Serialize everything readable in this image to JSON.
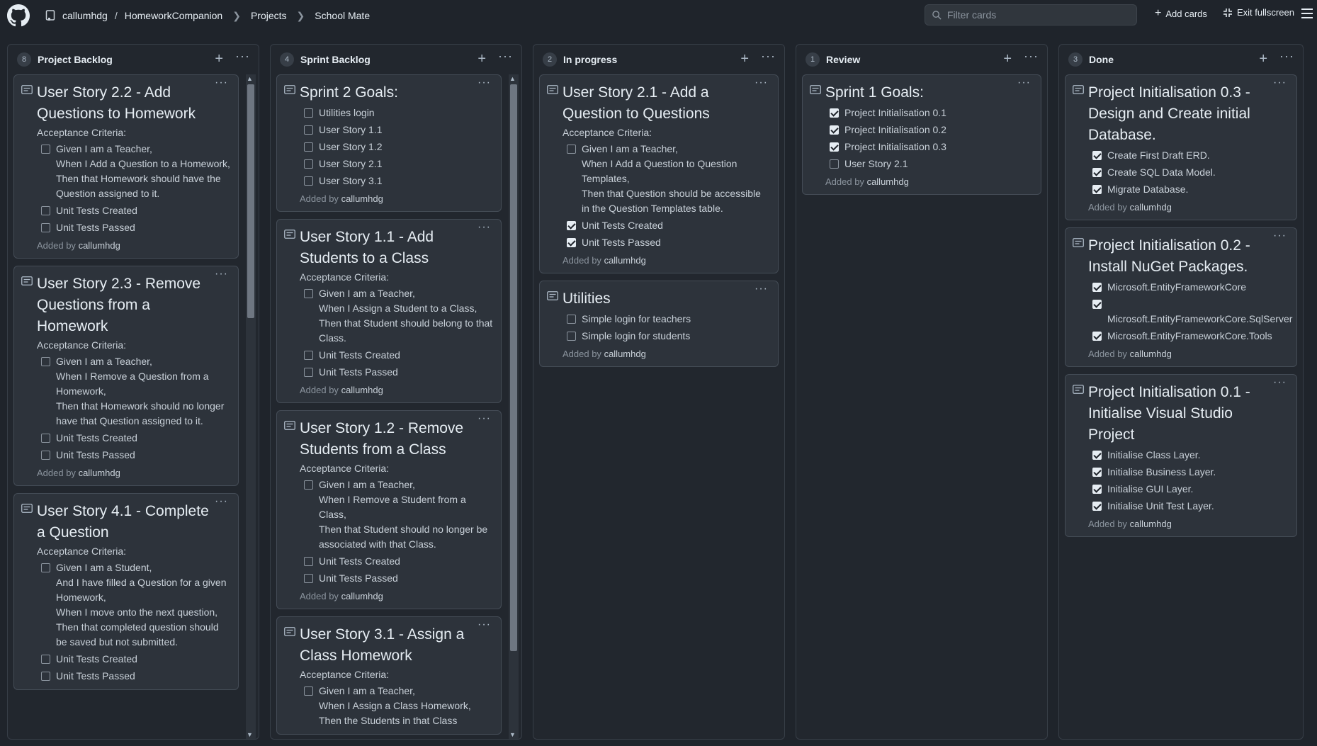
{
  "header": {
    "owner": "callumhdg",
    "repo": "HomeworkCompanion",
    "projects": "Projects",
    "project": "School Mate",
    "filter_placeholder": "Filter cards",
    "add_cards": "Add cards",
    "exit_fullscreen": "Exit fullscreen"
  },
  "columns": [
    {
      "count": "8",
      "title": "Project Backlog",
      "cards": [
        {
          "title": "User Story 2.2 - Add Questions to Homework",
          "sub": "Acceptance Criteria:",
          "items": [
            {
              "text": "Given I am a Teacher,\n When I Add a Question to a Homework,\n Then that Homework should have the Question assigned to it.",
              "checked": false
            },
            {
              "text": "Unit Tests Created",
              "checked": false
            },
            {
              "text": "Unit Tests Passed",
              "checked": false
            }
          ],
          "added_prefix": "Added by",
          "added_by": "callumhdg"
        },
        {
          "title": "User Story 2.3 - Remove Questions from a Homework",
          "sub": "Acceptance Criteria:",
          "items": [
            {
              "text": "Given I am a Teacher,\n When I Remove a Question from a Homework,\n Then that Homework should no longer have that Question assigned to it.",
              "checked": false
            },
            {
              "text": "Unit Tests Created",
              "checked": false
            },
            {
              "text": "Unit Tests Passed",
              "checked": false
            }
          ],
          "added_prefix": "Added by",
          "added_by": "callumhdg"
        },
        {
          "title": "User Story 4.1 - Complete a Question",
          "sub": "Acceptance Criteria:",
          "items": [
            {
              "text": "Given I am a Student,\n And I have filled a Question for a given Homework,\n When I move onto the next question,\n Then that completed question should be saved but not submitted.",
              "checked": false
            },
            {
              "text": "Unit Tests Created",
              "checked": false
            },
            {
              "text": "Unit Tests Passed",
              "checked": false
            }
          ],
          "added_prefix": "",
          "added_by": ""
        }
      ]
    },
    {
      "count": "4",
      "title": "Sprint Backlog",
      "cards": [
        {
          "title": "Sprint 2 Goals:",
          "sub": "",
          "items": [
            {
              "text": "Utilities login",
              "checked": false
            },
            {
              "text": "User Story 1.1",
              "checked": false
            },
            {
              "text": "User Story 1.2",
              "checked": false
            },
            {
              "text": "User Story 2.1",
              "checked": false
            },
            {
              "text": "User Story 3.1",
              "checked": false
            }
          ],
          "added_prefix": "Added by",
          "added_by": "callumhdg"
        },
        {
          "title": "User Story 1.1 - Add Students to a Class",
          "sub": "Acceptance Criteria:",
          "items": [
            {
              "text": "Given I am a Teacher,\n When I Assign a Student to a Class,\n Then that Student should belong to that Class.",
              "checked": false
            },
            {
              "text": "Unit Tests Created",
              "checked": false
            },
            {
              "text": "Unit Tests Passed",
              "checked": false
            }
          ],
          "added_prefix": "Added by",
          "added_by": "callumhdg"
        },
        {
          "title": "User Story 1.2 - Remove Students from a Class",
          "sub": "Acceptance Criteria:",
          "items": [
            {
              "text": "Given I am a Teacher,\n When I Remove a Student from a Class,\n Then that Student should no longer be associated with that Class.",
              "checked": false
            },
            {
              "text": "Unit Tests Created",
              "checked": false
            },
            {
              "text": "Unit Tests Passed",
              "checked": false
            }
          ],
          "added_prefix": "Added by",
          "added_by": "callumhdg"
        },
        {
          "title": "User Story 3.1 - Assign a Class Homework",
          "sub": "Acceptance Criteria:",
          "items": [
            {
              "text": "Given I am a Teacher,\n When I Assign a Class Homework,\n Then the Students in that Class",
              "checked": false
            }
          ],
          "added_prefix": "",
          "added_by": ""
        }
      ]
    },
    {
      "count": "2",
      "title": "In progress",
      "cards": [
        {
          "title": "User Story 2.1 - Add a Question to Questions",
          "sub": "Acceptance Criteria:",
          "items": [
            {
              "text": "Given I am a Teacher,\n When I Add a Question to Question Templates,\n Then that Question should be accessible in the Question Templates table.",
              "checked": false
            },
            {
              "text": "Unit Tests Created",
              "checked": true
            },
            {
              "text": "Unit Tests Passed",
              "checked": true
            }
          ],
          "added_prefix": "Added by",
          "added_by": "callumhdg"
        },
        {
          "title": "Utilities",
          "sub": "",
          "items": [
            {
              "text": "Simple login for teachers",
              "checked": false
            },
            {
              "text": "Simple login for students",
              "checked": false
            }
          ],
          "added_prefix": "Added by",
          "added_by": "callumhdg"
        }
      ]
    },
    {
      "count": "1",
      "title": "Review",
      "cards": [
        {
          "title": "Sprint 1 Goals:",
          "sub": "",
          "items": [
            {
              "text": "Project Initialisation 0.1",
              "checked": true
            },
            {
              "text": "Project Initialisation 0.2",
              "checked": true
            },
            {
              "text": "Project Initialisation 0.3",
              "checked": true
            },
            {
              "text": "User Story 2.1",
              "checked": false
            }
          ],
          "added_prefix": "Added by",
          "added_by": "callumhdg"
        }
      ]
    },
    {
      "count": "3",
      "title": "Done",
      "cards": [
        {
          "title": "Project Initialisation 0.3 - Design and Create initial Database.",
          "sub": "",
          "items": [
            {
              "text": "Create First Draft ERD.",
              "checked": true
            },
            {
              "text": "Create SQL Data Model.",
              "checked": true
            },
            {
              "text": "Migrate Database.",
              "checked": true
            }
          ],
          "added_prefix": "Added by",
          "added_by": "callumhdg"
        },
        {
          "title": "Project Initialisation 0.2 - Install NuGet Packages.",
          "sub": "",
          "items": [
            {
              "text": "Microsoft.EntityFrameworkCore",
              "checked": true
            },
            {
              "text": "\nMicrosoft.EntityFrameworkCore.SqlServer",
              "checked": true
            },
            {
              "text": "Microsoft.EntityFrameworkCore.Tools",
              "checked": true
            }
          ],
          "added_prefix": "Added by",
          "added_by": "callumhdg"
        },
        {
          "title": "Project Initialisation 0.1 - Initialise Visual Studio Project",
          "sub": "",
          "items": [
            {
              "text": "Initialise Class Layer.",
              "checked": true
            },
            {
              "text": "Initialise Business Layer.",
              "checked": true
            },
            {
              "text": "Initialise GUI Layer.",
              "checked": true
            },
            {
              "text": "Initialise Unit Test Layer.",
              "checked": true
            }
          ],
          "added_prefix": "Added by",
          "added_by": "callumhdg"
        }
      ]
    }
  ],
  "colors": {
    "bg": "#1f242b",
    "column": "#22272e",
    "card": "#2d333b",
    "border": "#444c56"
  }
}
